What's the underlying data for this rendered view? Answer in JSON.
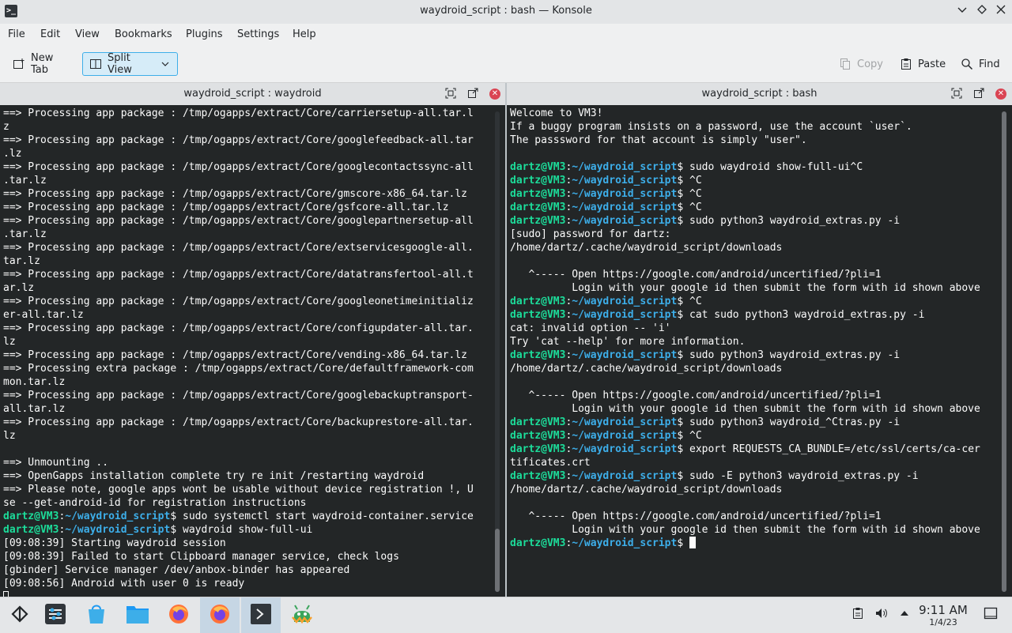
{
  "window": {
    "title": "waydroid_script : bash — Konsole"
  },
  "menu": [
    "File",
    "Edit",
    "View",
    "Bookmarks",
    "Plugins",
    "Settings",
    "Help"
  ],
  "toolbar": {
    "new_tab": "New Tab",
    "split_view": "Split View",
    "copy": "Copy",
    "paste": "Paste",
    "find": "Find"
  },
  "left_pane": {
    "title": "waydroid_script : waydroid",
    "lines": [
      {
        "text": "==> Processing app package : /tmp/ogapps/extract/Core/carriersetup-all.tar.l"
      },
      {
        "text": "z"
      },
      {
        "text": "==> Processing app package : /tmp/ogapps/extract/Core/googlefeedback-all.tar"
      },
      {
        "text": ".lz"
      },
      {
        "text": "==> Processing app package : /tmp/ogapps/extract/Core/googlecontactssync-all"
      },
      {
        "text": ".tar.lz"
      },
      {
        "text": "==> Processing app package : /tmp/ogapps/extract/Core/gmscore-x86_64.tar.lz"
      },
      {
        "text": "==> Processing app package : /tmp/ogapps/extract/Core/gsfcore-all.tar.lz"
      },
      {
        "text": "==> Processing app package : /tmp/ogapps/extract/Core/googlepartnersetup-all"
      },
      {
        "text": ".tar.lz"
      },
      {
        "text": "==> Processing app package : /tmp/ogapps/extract/Core/extservicesgoogle-all."
      },
      {
        "text": "tar.lz"
      },
      {
        "text": "==> Processing app package : /tmp/ogapps/extract/Core/datatransfertool-all.t"
      },
      {
        "text": "ar.lz"
      },
      {
        "text": "==> Processing app package : /tmp/ogapps/extract/Core/googleonetimeinitializ"
      },
      {
        "text": "er-all.tar.lz"
      },
      {
        "text": "==> Processing app package : /tmp/ogapps/extract/Core/configupdater-all.tar."
      },
      {
        "text": "lz"
      },
      {
        "text": "==> Processing app package : /tmp/ogapps/extract/Core/vending-x86_64.tar.lz"
      },
      {
        "text": "==> Processing extra package : /tmp/ogapps/extract/Core/defaultframework-com"
      },
      {
        "text": "mon.tar.lz"
      },
      {
        "text": "==> Processing app package : /tmp/ogapps/extract/Core/googlebackuptransport-"
      },
      {
        "text": "all.tar.lz"
      },
      {
        "text": "==> Processing app package : /tmp/ogapps/extract/Core/backuprestore-all.tar."
      },
      {
        "text": "lz"
      },
      {
        "text": ""
      },
      {
        "text": "==> Unmounting .."
      },
      {
        "text": "==> OpenGapps installation complete try re init /restarting waydroid"
      },
      {
        "text": "==> Please note, google apps wont be usable without device registration !, U"
      },
      {
        "text": "se --get-android-id for registration instructions"
      },
      {
        "prompt": true,
        "user": "dartz@VM3",
        "path": "~/waydroid_script",
        "cmd": "$ sudo systemctl start waydroid-container.service"
      },
      {
        "prompt": true,
        "user": "dartz@VM3",
        "path": "~/waydroid_script",
        "cmd": "$ waydroid show-full-ui"
      },
      {
        "text": "[09:08:39] Starting waydroid session"
      },
      {
        "text": "[09:08:39] Failed to start Clipboard manager service, check logs"
      },
      {
        "text": "[gbinder] Service manager /dev/anbox-binder has appeared"
      },
      {
        "text": "[09:08:56] Android with user 0 is ready"
      },
      {
        "cursor": "outline"
      }
    ]
  },
  "right_pane": {
    "title": "waydroid_script : bash",
    "lines": [
      {
        "text": "Welcome to VM3!"
      },
      {
        "text": "If a buggy program insists on a password, use the account `user`."
      },
      {
        "text": "The passsword for that account is simply \"user\"."
      },
      {
        "text": ""
      },
      {
        "prompt": true,
        "user": "dartz@VM3",
        "path": "~/waydroid_script",
        "cmd": "$ sudo waydroid show-full-ui^C"
      },
      {
        "prompt": true,
        "user": "dartz@VM3",
        "path": "~/waydroid_script",
        "cmd": "$ ^C"
      },
      {
        "prompt": true,
        "user": "dartz@VM3",
        "path": "~/waydroid_script",
        "cmd": "$ ^C"
      },
      {
        "prompt": true,
        "user": "dartz@VM3",
        "path": "~/waydroid_script",
        "cmd": "$ ^C"
      },
      {
        "prompt": true,
        "user": "dartz@VM3",
        "path": "~/waydroid_script",
        "cmd": "$ sudo python3 waydroid_extras.py -i"
      },
      {
        "text": "[sudo] password for dartz:"
      },
      {
        "text": "/home/dartz/.cache/waydroid_script/downloads"
      },
      {
        "text": ""
      },
      {
        "text": "   ^----- Open https://google.com/android/uncertified/?pli=1"
      },
      {
        "text": "          Login with your google id then submit the form with id shown above"
      },
      {
        "prompt": true,
        "user": "dartz@VM3",
        "path": "~/waydroid_script",
        "cmd": "$ ^C"
      },
      {
        "prompt": true,
        "user": "dartz@VM3",
        "path": "~/waydroid_script",
        "cmd": "$ cat sudo python3 waydroid_extras.py -i"
      },
      {
        "text": "cat: invalid option -- 'i'"
      },
      {
        "text": "Try 'cat --help' for more information."
      },
      {
        "prompt": true,
        "user": "dartz@VM3",
        "path": "~/waydroid_script",
        "cmd": "$ sudo python3 waydroid_extras.py -i"
      },
      {
        "text": "/home/dartz/.cache/waydroid_script/downloads"
      },
      {
        "text": ""
      },
      {
        "text": "   ^----- Open https://google.com/android/uncertified/?pli=1"
      },
      {
        "text": "          Login with your google id then submit the form with id shown above"
      },
      {
        "prompt": true,
        "user": "dartz@VM3",
        "path": "~/waydroid_script",
        "cmd": "$ sudo python3 waydroid_^Ctras.py -i"
      },
      {
        "prompt": true,
        "user": "dartz@VM3",
        "path": "~/waydroid_script",
        "cmd": "$ ^C"
      },
      {
        "prompt": true,
        "user": "dartz@VM3",
        "path": "~/waydroid_script",
        "cmd": "$ export REQUESTS_CA_BUNDLE=/etc/ssl/certs/ca-cer"
      },
      {
        "text": "tificates.crt"
      },
      {
        "prompt": true,
        "user": "dartz@VM3",
        "path": "~/waydroid_script",
        "cmd": "$ sudo -E python3 waydroid_extras.py -i"
      },
      {
        "text": "/home/dartz/.cache/waydroid_script/downloads"
      },
      {
        "text": ""
      },
      {
        "text": "   ^----- Open https://google.com/android/uncertified/?pli=1"
      },
      {
        "text": "          Login with your google id then submit the form with id shown above"
      },
      {
        "prompt": true,
        "user": "dartz@VM3",
        "path": "~/waydroid_script",
        "cmd": "$ ",
        "cursor": "solid"
      }
    ]
  },
  "taskbar": {
    "apps": [
      {
        "name": "application-launcher-icon"
      },
      {
        "name": "system-settings-icon"
      },
      {
        "name": "discover-store-icon"
      },
      {
        "name": "file-manager-icon"
      },
      {
        "name": "firefox-icon"
      },
      {
        "name": "firefox-icon-2",
        "active": true
      },
      {
        "name": "konsole-icon",
        "active": true
      },
      {
        "name": "waydroid-icon"
      }
    ],
    "clock_time": "9:11 AM",
    "clock_date": "1/4/23"
  },
  "colors": {
    "terminal_bg": "#232627",
    "prompt_user": "#1cdc9a",
    "prompt_path": "#3daee9",
    "accent": "#3daee9",
    "close_red": "#da4453"
  }
}
